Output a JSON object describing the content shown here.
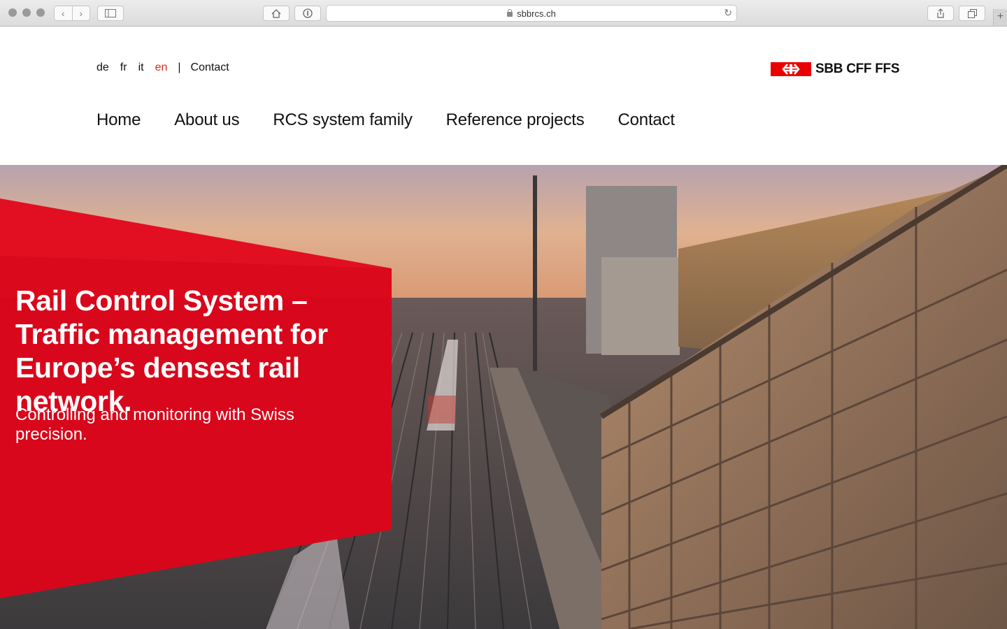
{
  "browser": {
    "url": "sbbrcs.ch",
    "back_icon": "chevron-left-icon",
    "forward_icon": "chevron-right-icon"
  },
  "header": {
    "languages": [
      {
        "code": "de",
        "active": false
      },
      {
        "code": "fr",
        "active": false
      },
      {
        "code": "it",
        "active": false
      },
      {
        "code": "en",
        "active": true
      }
    ],
    "separator": "|",
    "contact_link": "Contact",
    "logo_text": "SBB CFF FFS",
    "brand_color": "#eb0000"
  },
  "nav": {
    "items": [
      "Home",
      "About us",
      "RCS system family",
      "Reference projects",
      "Contact"
    ]
  },
  "hero": {
    "title": "Rail Control System – Traffic management for Europe’s densest rail network.",
    "subtitle": "Controlling and monitoring with Swiss precision."
  }
}
